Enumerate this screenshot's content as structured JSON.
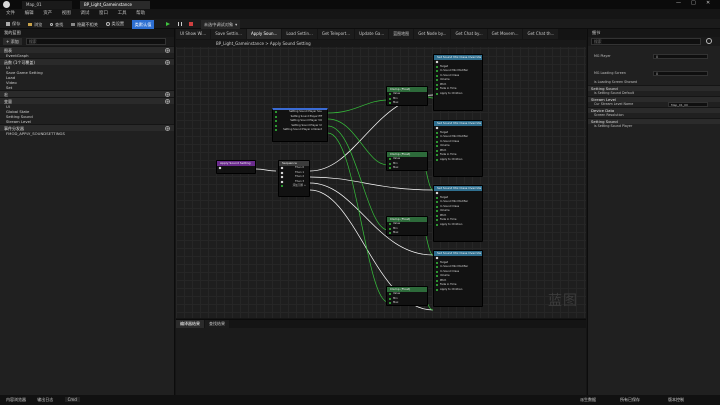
{
  "window": {
    "tabs": [
      "Map_01",
      "BP_Light_Gameinstance"
    ],
    "controls": [
      "—",
      "□",
      "✕"
    ]
  },
  "menu": [
    "文件",
    "编辑",
    "资产",
    "视图",
    "调试",
    "窗口",
    "工具",
    "帮助"
  ],
  "toolbar": {
    "items": [
      "保存",
      "浏览",
      "查找",
      "隐藏不相关",
      "类设置",
      "类默认值"
    ],
    "debug_target": "未选中调试对象"
  },
  "left_panel": {
    "title": "我的蓝图",
    "add_label": "+ 添加",
    "search_placeholder": "搜索",
    "sections": [
      {
        "label": "图表",
        "items": [
          "EventGraph"
        ]
      },
      {
        "label": "函数 (1个可覆盖)",
        "items": [
          "UI",
          "Save Game Setting",
          "Load",
          "Video",
          "Set"
        ]
      },
      {
        "label": "宏",
        "items": []
      },
      {
        "label": "变量",
        "items": [
          "UI",
          "Global State",
          "Setting Sound",
          "Stream Level"
        ]
      },
      {
        "label": "事件分发器",
        "items": [
          "FMOD_APPLY_SOUNDSETTINGS"
        ]
      }
    ]
  },
  "graph_tabs": [
    "UI Show Wi...",
    "Save Settin...",
    "Apply Soun...",
    "Load Settin...",
    "Get Teleport...",
    "Update Ga...",
    "蓝图地图",
    "Get Node by...",
    "Get Chat by...",
    "Get Movem...",
    "Get Chat th..."
  ],
  "breadcrumb": "BP_Light_Gameinstance > Apply Sound Setting",
  "graph": {
    "event_node": "Apply Sound Setting",
    "sequence_node": "Sequence",
    "sequence_pins": [
      "Then 0",
      "Then 1",
      "Then 2",
      "Then 3"
    ],
    "add_pin": "添加引脚 +",
    "variables": [
      "Setting Sound Player Sou",
      "Setting Sound Player Eff",
      "Setting Sound Player VO",
      "Setting Sound Player UI",
      "Setting Sound Player Ambient"
    ],
    "clamp_title": "Clamp (Float)",
    "clamp_pins": [
      "Value",
      "Min",
      "Max",
      "Return Value"
    ],
    "set_node_title": "Set Sound Mix Class Override",
    "set_node_pins": [
      "Target",
      "In Sound Mix Modifier",
      "In Sound Class",
      "Volume",
      "Pitch",
      "Fade in Time",
      "Apply to Children"
    ],
    "watermark": "蓝图"
  },
  "bottom_tabs": [
    "编译器结果",
    "查找结果"
  ],
  "right_panel": {
    "title": "细节",
    "search_placeholder": "搜索",
    "rows": [
      {
        "label": "MG Player",
        "value": "0"
      },
      {
        "label": "MG Loading Screen",
        "value": "0"
      },
      {
        "label": "is Loading Screen Showed",
        "value": ""
      }
    ],
    "sections": [
      "Setting Sound",
      "Stream Level",
      "Device Data",
      "Setting Sound"
    ],
    "extra_rows": [
      "is Setting Sound Default",
      "Cur Stream Level Name",
      "Screen Resolution",
      "is Setting Sound Player"
    ],
    "stream_value": "Map_01_00"
  },
  "status_bar": {
    "items": [
      "内容浏览器",
      "输出日志",
      "Cmd"
    ],
    "right": [
      "派生数据",
      "所有已保存",
      "版本控制"
    ]
  }
}
